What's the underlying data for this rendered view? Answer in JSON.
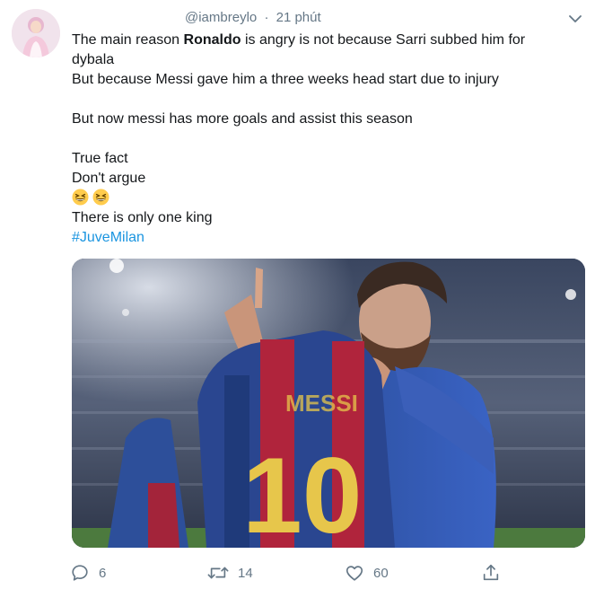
{
  "tweet": {
    "handle": "@iambreylo",
    "separator": "·",
    "time": "21 phút",
    "lines": {
      "l1_prefix": "The main reason ",
      "l1_bold": "Ronaldo",
      "l1_suffix": " is angry is not because Sarri subbed him for",
      "l2": "dybala",
      "l3": "But because Messi gave him a three weeks head start due to injury",
      "l5": "But now messi has more goals and assist this season",
      "l7": "True fact",
      "l8": "Don't argue",
      "l10": "There is only one king",
      "hashtag": "#JuveMilan"
    },
    "emojis": [
      "grinning-squinting-face",
      "grinning-squinting-face"
    ],
    "media": {
      "jersey_name": "MESSI",
      "jersey_number": "10"
    },
    "actions": {
      "replies": "6",
      "retweets": "14",
      "likes": "60"
    }
  },
  "colors": {
    "text": "#14171a",
    "secondary": "#657786",
    "link": "#1b95e0"
  }
}
